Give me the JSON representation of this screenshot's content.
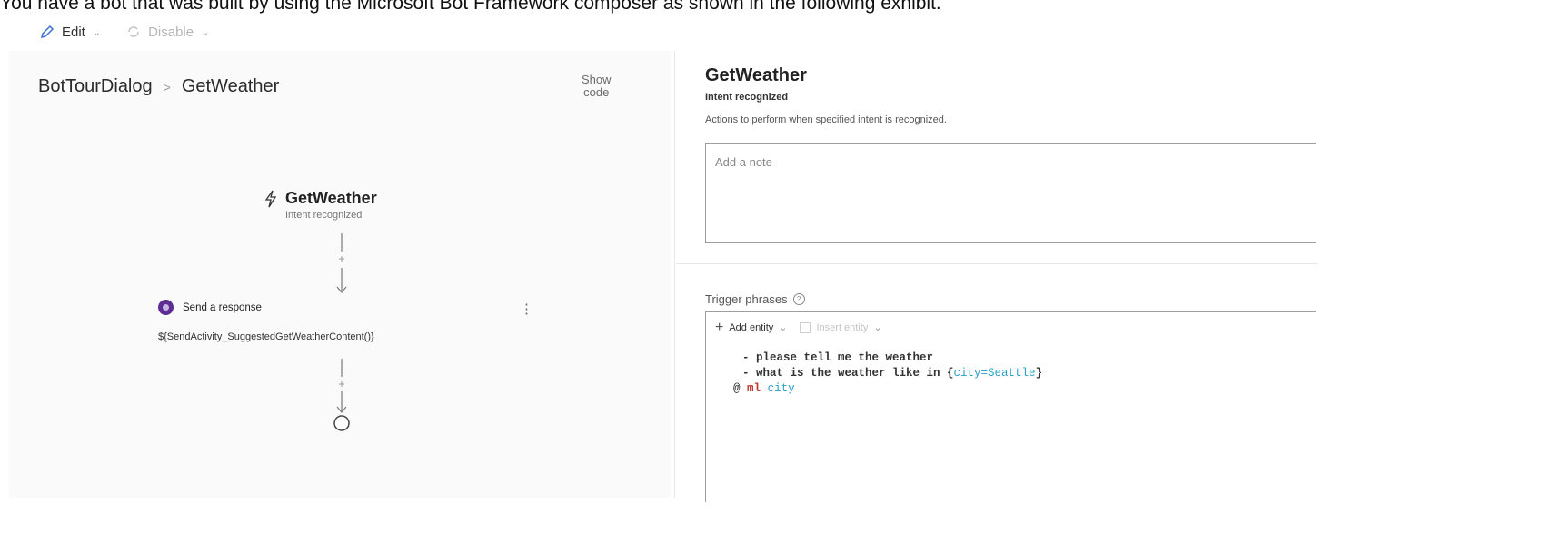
{
  "question": "You have a bot that was built by using the Microsoft Bot Framework composer as shown in the following exhibit.",
  "toolbar": {
    "edit_label": "Edit",
    "disable_label": "Disable"
  },
  "breadcrumb": {
    "root": "BotTourDialog",
    "current": "GetWeather"
  },
  "show_code": {
    "line1": "Show",
    "line2": "code"
  },
  "canvas": {
    "trigger_title": "GetWeather",
    "trigger_subtitle": "Intent recognized",
    "action_title": "Send a response",
    "action_body": "${SendActivity_SuggestedGetWeatherContent()}"
  },
  "panel": {
    "title": "GetWeather",
    "subtitle": "Intent recognized",
    "description": "Actions to perform when specified intent is recognized.",
    "note_placeholder": "Add a note",
    "trigger_label": "Trigger phrases",
    "add_entity_label": "Add entity",
    "insert_entity_label": "Insert entity",
    "phrase1": "- please tell me the weather",
    "phrase2_prefix": "- what is the weather like in {",
    "phrase2_entity": "city=Seattle",
    "phrase2_suffix": "}",
    "entity_at": "@",
    "entity_type": "ml",
    "entity_name": "city"
  }
}
